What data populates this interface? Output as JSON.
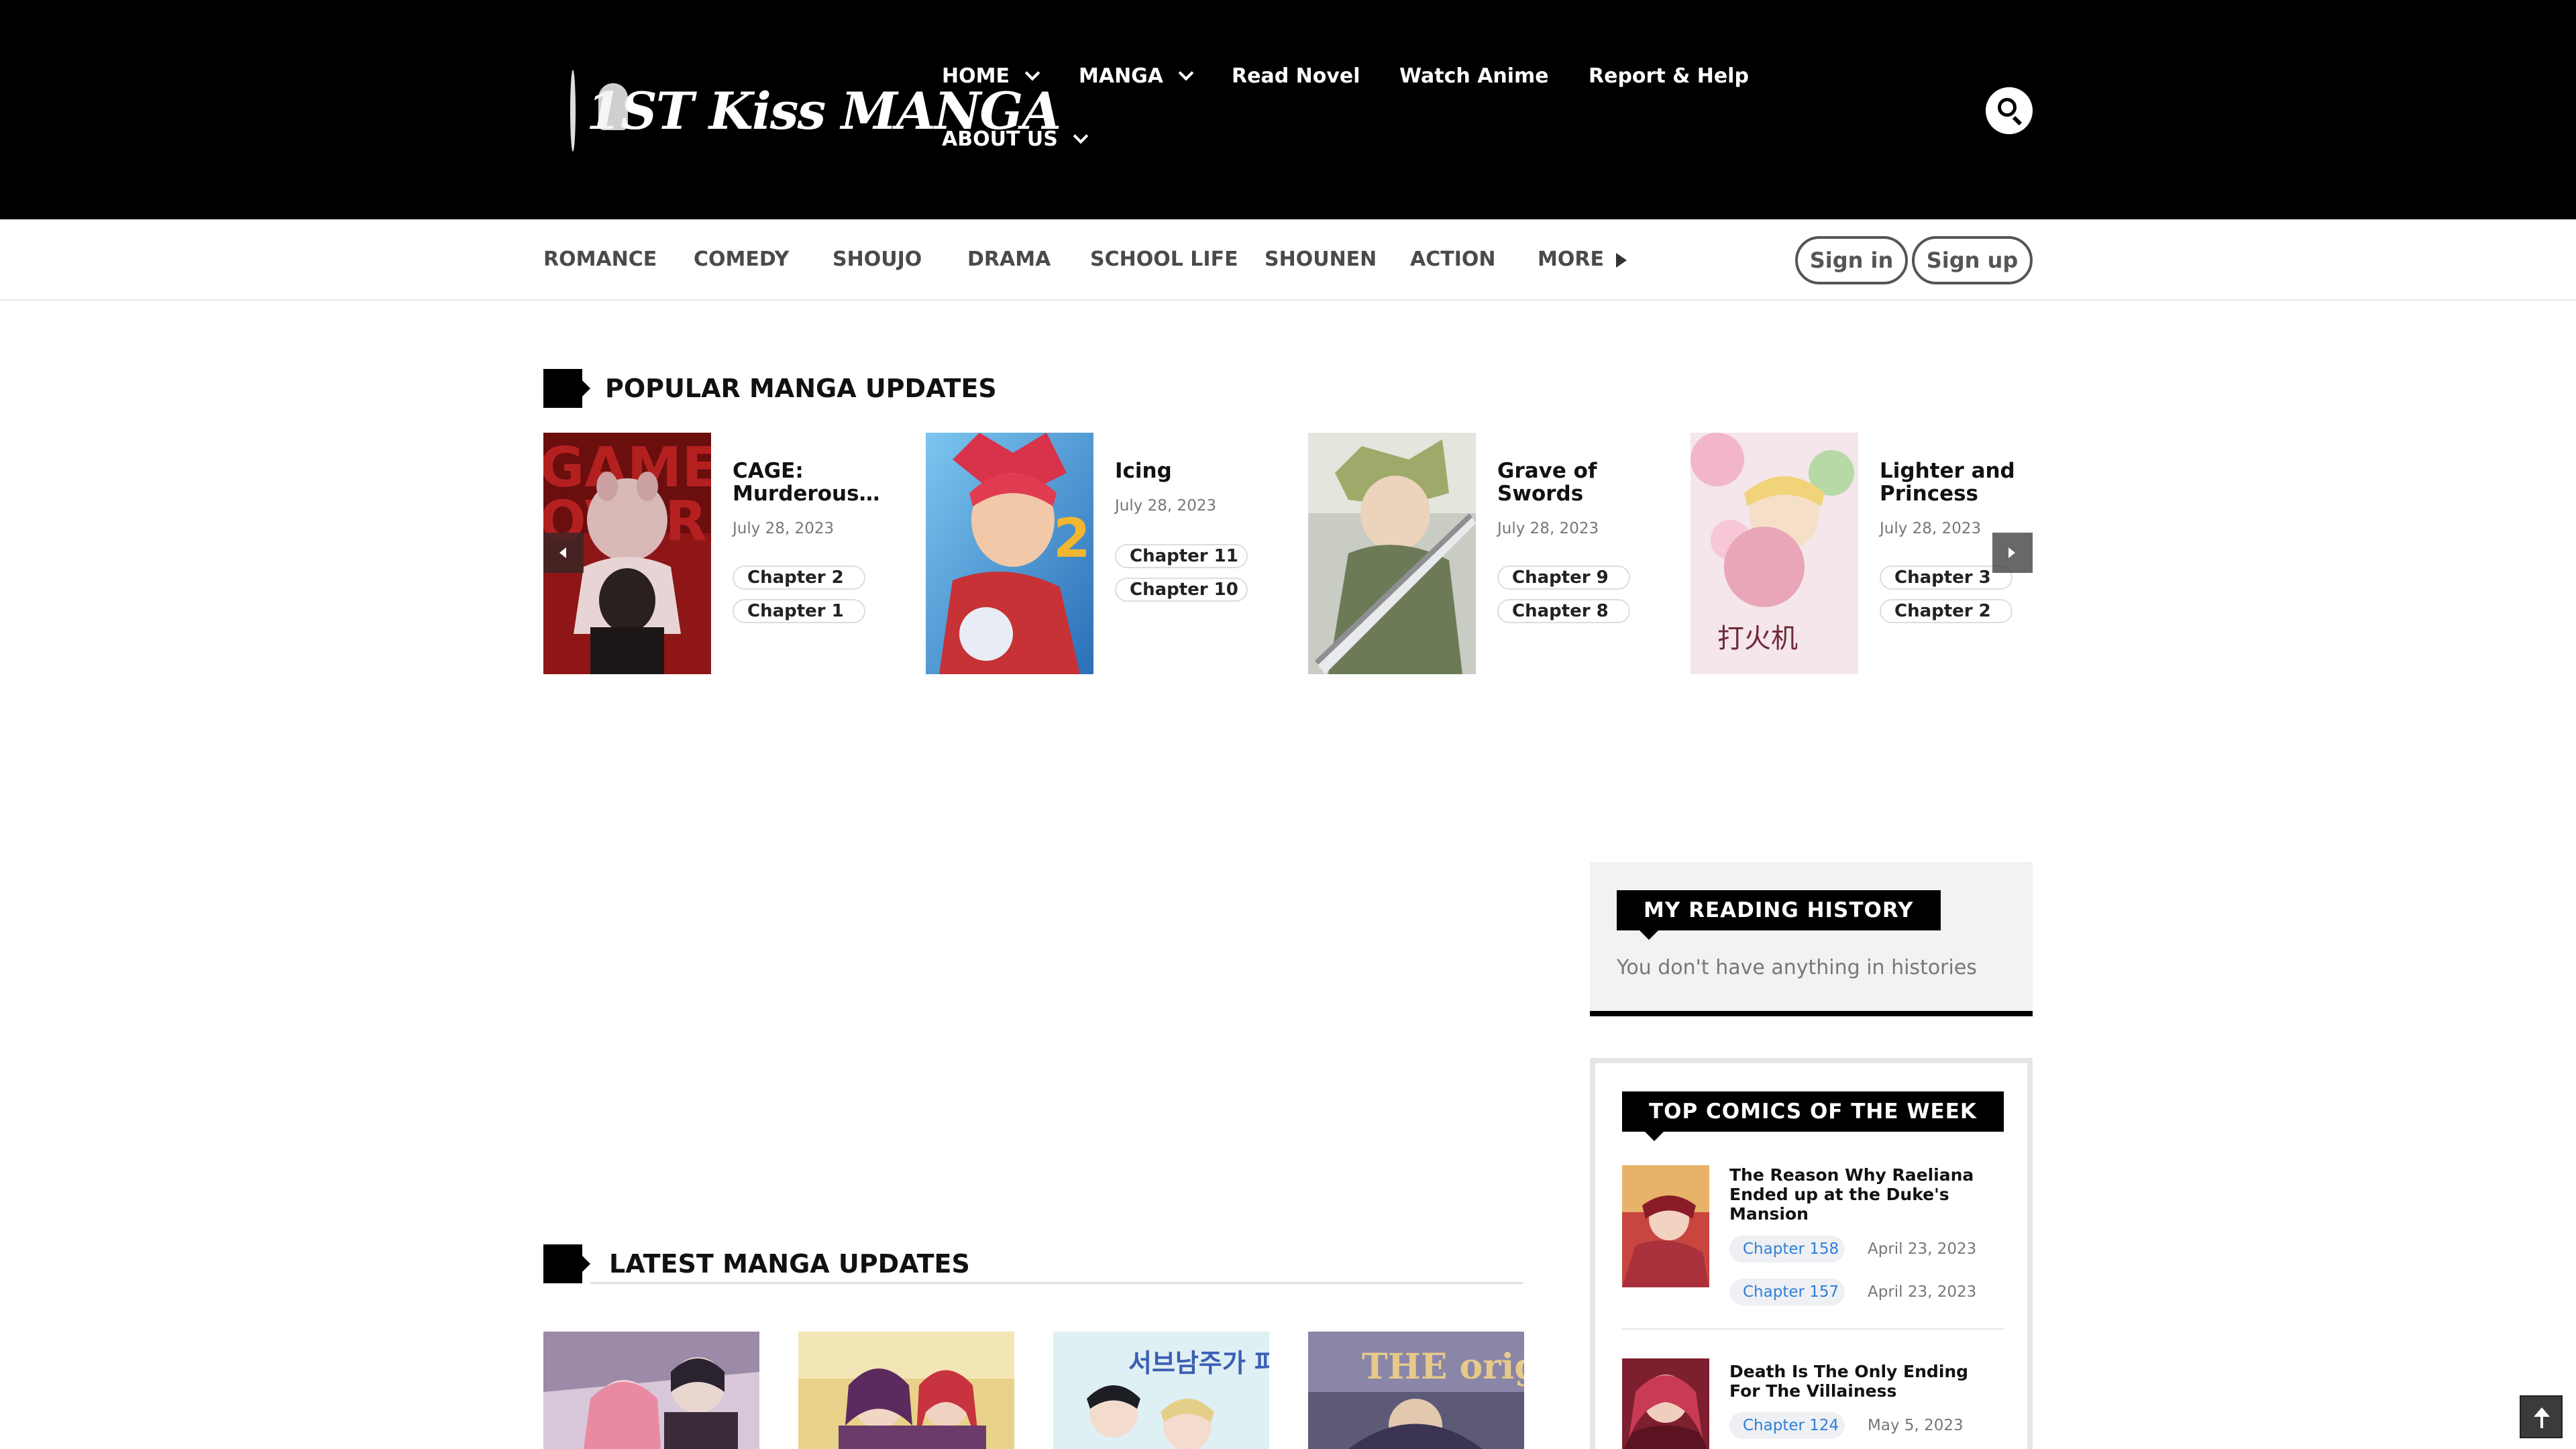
{
  "header": {
    "logo_text": "1ST Kiss MANGA",
    "nav": {
      "home": "HOME",
      "manga": "MANGA",
      "read_novel": "Read Novel",
      "watch_anime": "Watch Anime",
      "report_help": "Report & Help",
      "about_us": "ABOUT US"
    }
  },
  "genre_bar": {
    "genres": [
      "ROMANCE",
      "COMEDY",
      "SHOUJO",
      "DRAMA",
      "SCHOOL LIFE",
      "SHOUNEN",
      "ACTION"
    ],
    "more": "MORE",
    "sign_in": "Sign in",
    "sign_up": "Sign up"
  },
  "popular": {
    "title": "POPULAR MANGA UPDATES",
    "items": [
      {
        "title": "CAGE: Murderous…",
        "date": "July 28, 2023",
        "chapters": [
          "Chapter 2",
          "Chapter 1"
        ]
      },
      {
        "title": "Icing",
        "date": "July 28, 2023",
        "chapters": [
          "Chapter 11",
          "Chapter 10"
        ]
      },
      {
        "title": "Grave of Swords",
        "date": "July 28, 2023",
        "chapters": [
          "Chapter 9",
          "Chapter 8"
        ]
      },
      {
        "title": "Lighter and Princess",
        "date": "July 28, 2023",
        "chapters": [
          "Chapter 3",
          "Chapter 2"
        ]
      }
    ]
  },
  "history": {
    "title": "MY READING HISTORY",
    "empty_text": "You don't have anything in histories"
  },
  "top_comics": {
    "title": "TOP COMICS OF THE WEEK",
    "items": [
      {
        "title": "The Reason Why Raeliana Ended up at the Duke's Mansion",
        "chapters": [
          {
            "label": "Chapter 158",
            "date": "April 23, 2023"
          },
          {
            "label": "Chapter 157",
            "date": "April 23, 2023"
          }
        ]
      },
      {
        "title": "Death Is The Only Ending For The Villainess",
        "chapters": [
          {
            "label": "Chapter 124",
            "date": "May 5, 2023"
          }
        ]
      }
    ]
  },
  "latest": {
    "title": "LATEST MANGA UPDATES",
    "cover_text": {
      "korean": "서브남주가 파업하면 생기는 일",
      "origin": "THE origin"
    }
  },
  "colors": {
    "header_bg": "#000000",
    "accent_blue": "#2f7fd8",
    "sidebar_bg": "#f2f2f2"
  },
  "icons": [
    "search-icon",
    "chevron-down-icon",
    "caret-right-icon",
    "arrow-left-icon",
    "arrow-right-icon",
    "back-to-top-icon"
  ]
}
